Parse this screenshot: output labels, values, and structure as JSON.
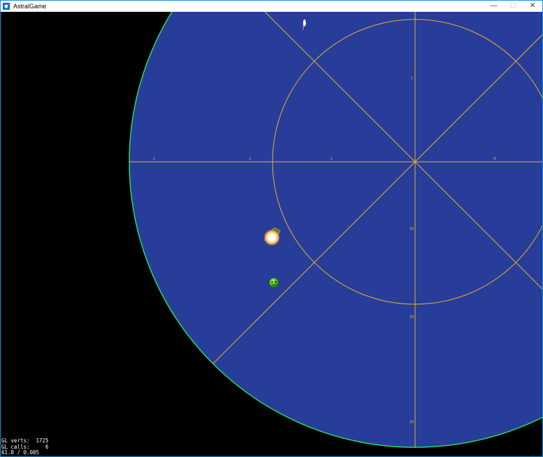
{
  "window": {
    "title": "AstralGame",
    "controls": {
      "minimize": "—",
      "maximize": "☐",
      "close": "✕"
    }
  },
  "scene": {
    "colors": {
      "background": "#000000",
      "planet_fill": "#283c9a",
      "planet_edge": "#22dd66",
      "grid_lines": "#e0b62a"
    },
    "grid_labels": {
      "west_far": "3",
      "west_mid": "3",
      "west_near": "3",
      "east": "8",
      "north": "C",
      "south_near": "ID",
      "south_mid": "ID",
      "south_far": "ID"
    },
    "entities": [
      {
        "name": "falling-meteor",
        "kind": "projectile"
      },
      {
        "name": "player-ship",
        "kind": "player",
        "state": "firing"
      },
      {
        "name": "green-blob-enemy",
        "kind": "enemy"
      }
    ]
  },
  "debug": {
    "gl_verts_label": "GL verts:",
    "gl_verts_value": "1725",
    "gl_calls_label": "GL calls:",
    "gl_calls_value": "6",
    "fps_line": "61.0 / 0.005"
  }
}
